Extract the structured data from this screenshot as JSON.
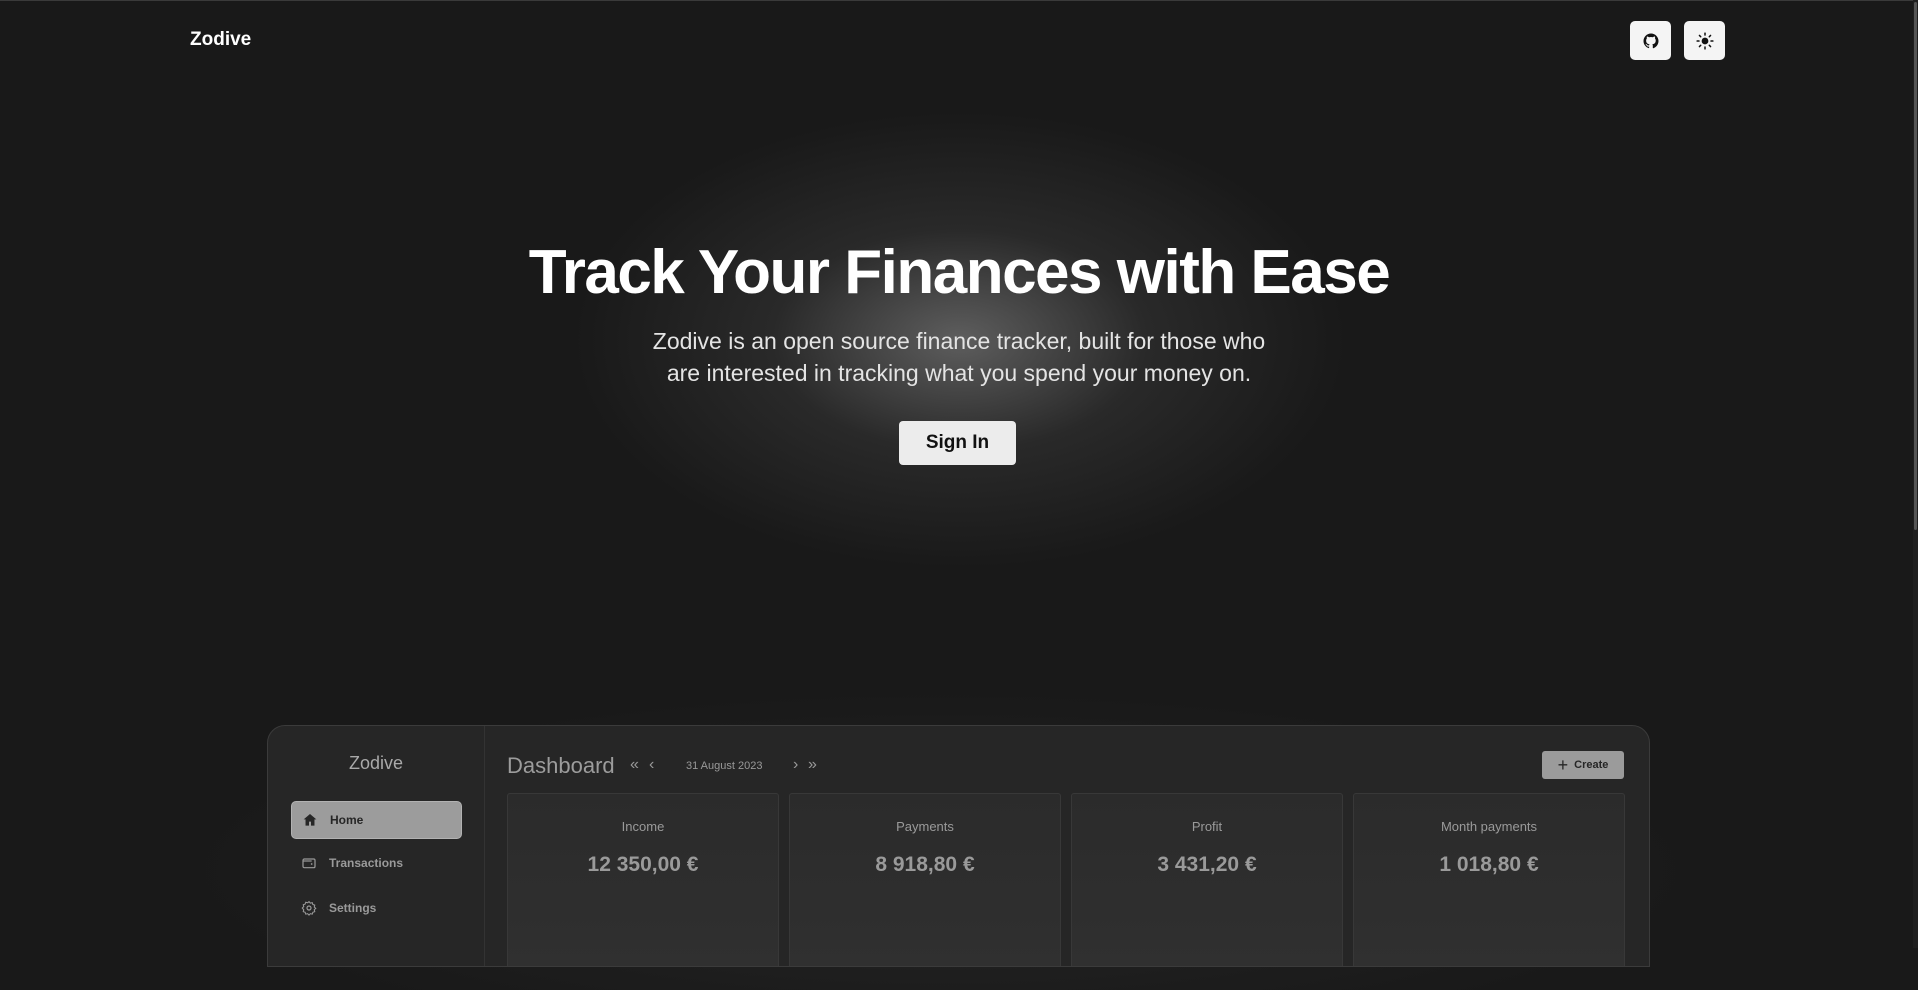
{
  "header": {
    "brand": "Zodive",
    "github_icon": "github-icon",
    "theme_icon": "sun-icon"
  },
  "hero": {
    "title": "Track Your Finances with Ease",
    "subtitle_line1": "Zodive is an open source finance tracker, built for those who",
    "subtitle_line2": "are interested in tracking what you spend your money on.",
    "signin_label": "Sign In"
  },
  "preview": {
    "brand": "Zodive",
    "nav": [
      {
        "label": "Home",
        "icon": "home-icon",
        "active": true
      },
      {
        "label": "Transactions",
        "icon": "wallet-icon",
        "active": false
      },
      {
        "label": "Settings",
        "icon": "gear-icon",
        "active": false
      }
    ],
    "title": "Dashboard",
    "date": "31 August 2023",
    "create_label": "Create",
    "cards": [
      {
        "label": "Income",
        "value": "12 350,00 €"
      },
      {
        "label": "Payments",
        "value": "8 918,80 €"
      },
      {
        "label": "Profit",
        "value": "3 431,20 €"
      },
      {
        "label": "Month payments",
        "value": "1 018,80 €"
      }
    ]
  }
}
